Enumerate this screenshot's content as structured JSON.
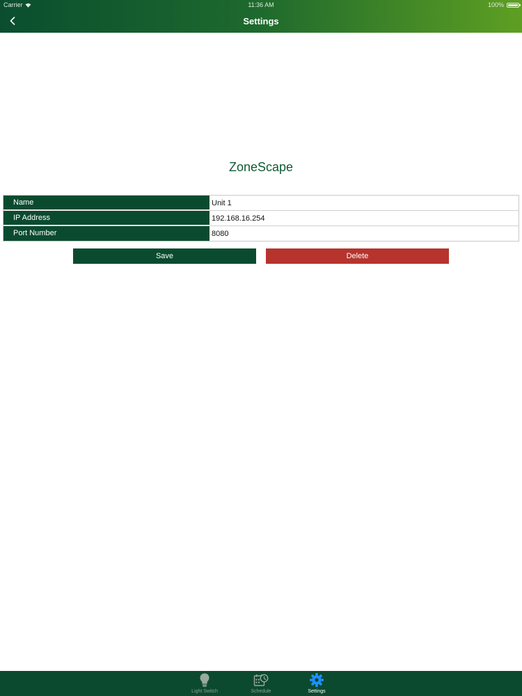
{
  "status_bar": {
    "carrier": "Carrier",
    "time": "11:36 AM",
    "battery": "100%"
  },
  "nav": {
    "back_icon": "chevron-left-icon",
    "title": "Settings"
  },
  "app_title": "ZoneScape",
  "form": {
    "rows": [
      {
        "label": "Name",
        "value": "Unit 1"
      },
      {
        "label": "IP Address",
        "value": "192.168.16.254"
      },
      {
        "label": "Port Number",
        "value": "8080"
      }
    ]
  },
  "buttons": {
    "save_label": "Save",
    "delete_label": "Delete"
  },
  "tabs": [
    {
      "label": "Light Switch",
      "icon": "lightbulb-icon",
      "active": false
    },
    {
      "label": "Schedule",
      "icon": "calendar-clock-icon",
      "active": false
    },
    {
      "label": "Settings",
      "icon": "gear-icon",
      "active": true
    }
  ],
  "colors": {
    "brand_green": "#0a4b2f",
    "accent_blue": "#1e8fff",
    "delete_red": "#b6342d"
  }
}
